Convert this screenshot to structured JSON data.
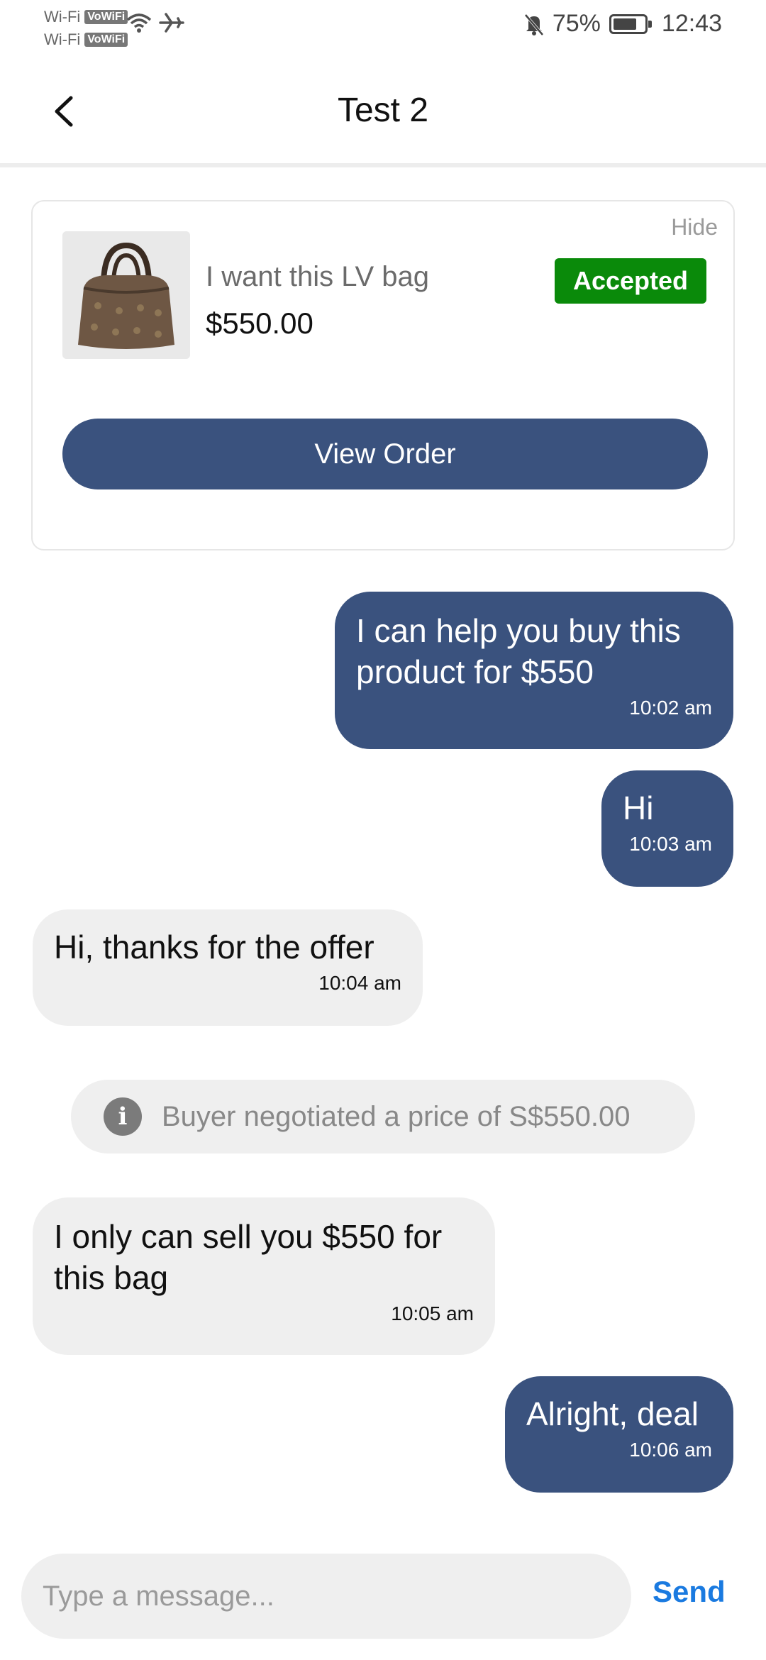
{
  "status_bar": {
    "wifi1": "Wi-Fi",
    "wifi2": "Wi-Fi",
    "vowifi": "VoWiFi",
    "battery": "75%",
    "time": "12:43"
  },
  "header": {
    "title": "Test 2"
  },
  "order_card": {
    "hide_label": "Hide",
    "product_name": "I want this LV bag",
    "price": "$550.00",
    "status": "Accepted",
    "view_order_label": "View Order"
  },
  "messages": [
    {
      "text": "I can help you buy this product for $550",
      "time": "10:02 am",
      "direction": "out"
    },
    {
      "text": "Hi",
      "time": "10:03 am",
      "direction": "out"
    },
    {
      "text": "Hi, thanks for the offer",
      "time": "10:04 am",
      "direction": "in"
    },
    {
      "text": "I only can sell you $550 for this bag",
      "time": "10:05 am",
      "direction": "in"
    },
    {
      "text": "Alright, deal",
      "time": "10:06 am",
      "direction": "out"
    }
  ],
  "system_note": {
    "text": "Buyer negotiated a price of S$550.00",
    "icon": "info-icon"
  },
  "composer": {
    "placeholder": "Type a message...",
    "send_label": "Send"
  },
  "colors": {
    "accent": "#3a527e",
    "accepted": "#0a8a0a",
    "send": "#1a7ae0"
  }
}
